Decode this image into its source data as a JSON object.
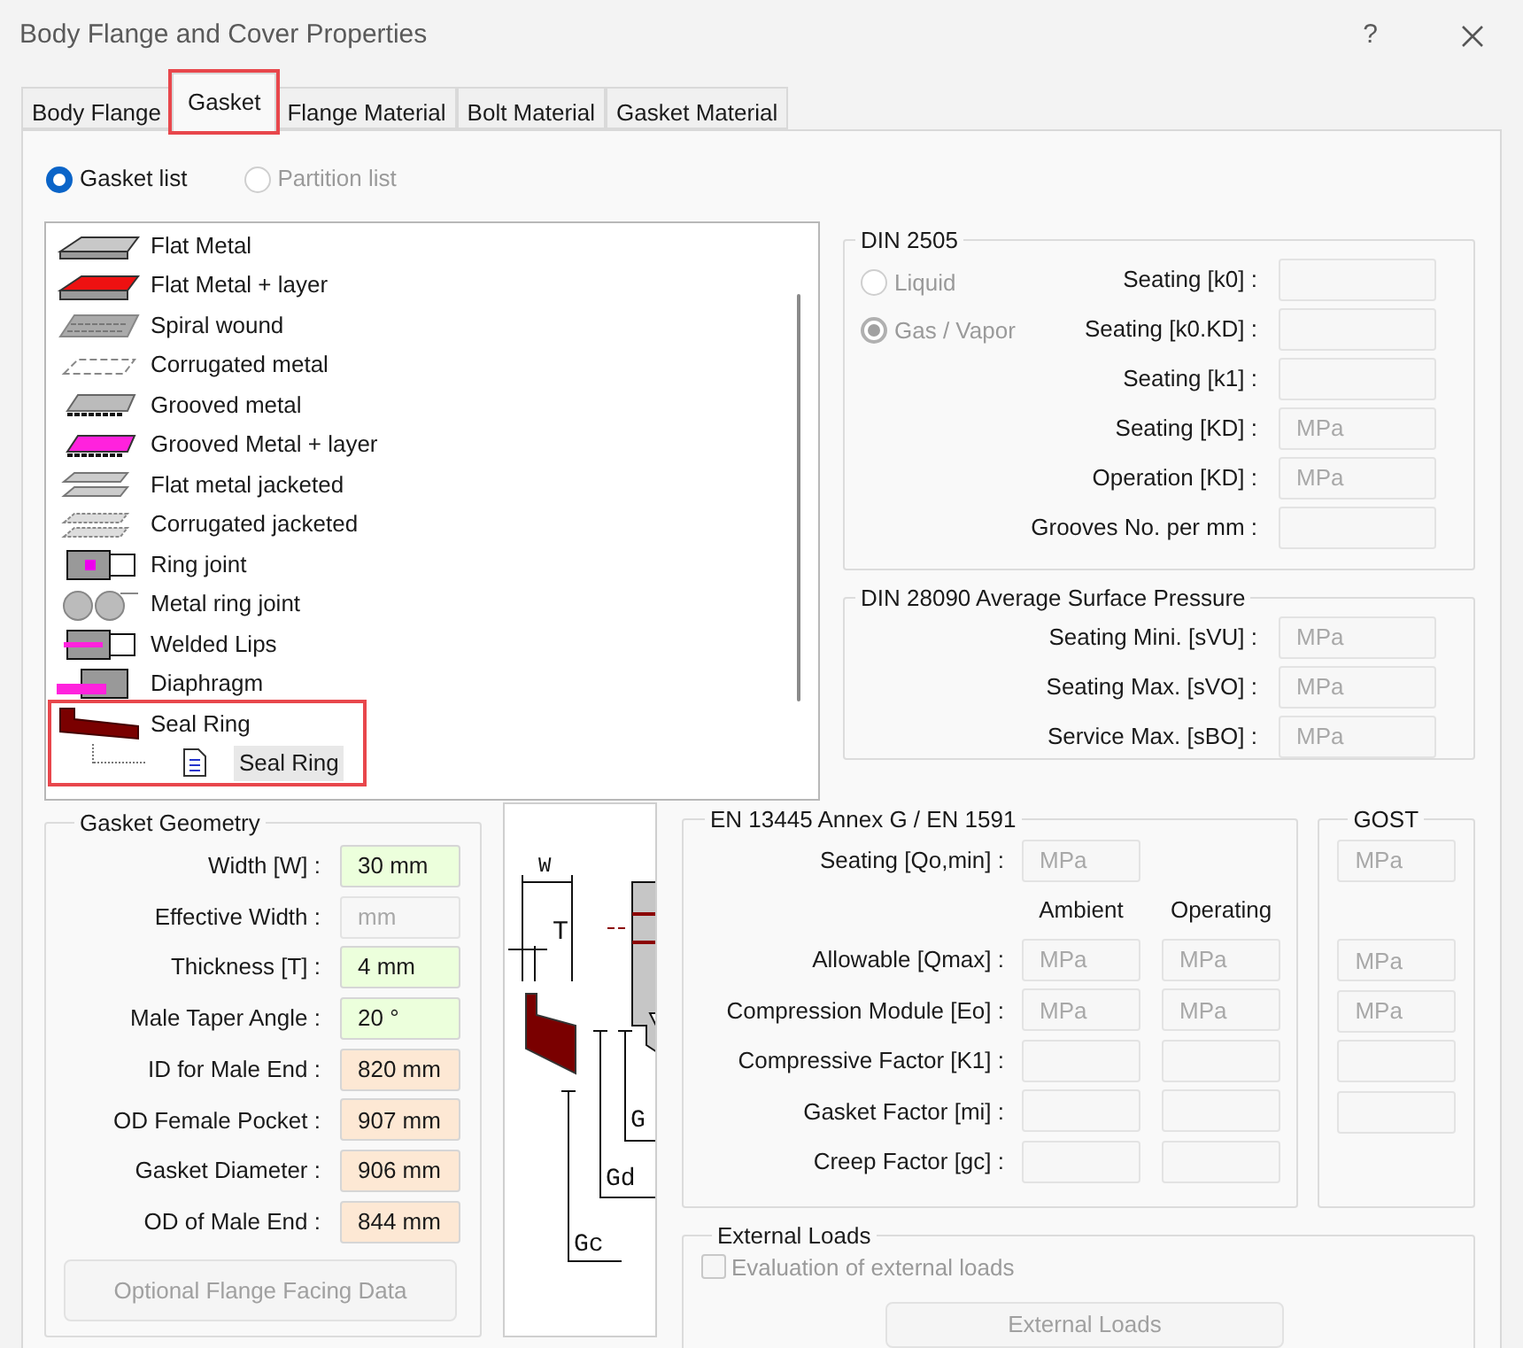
{
  "window": {
    "title": "Body Flange and Cover Properties",
    "help": "?"
  },
  "tabs": [
    {
      "label": "Body Flange",
      "selected": false,
      "highlighted": false
    },
    {
      "label": "Gasket",
      "selected": true,
      "highlighted": true
    },
    {
      "label": "Flange Material",
      "selected": false,
      "highlighted": false
    },
    {
      "label": "Bolt Material",
      "selected": false,
      "highlighted": false
    },
    {
      "label": "Gasket Material",
      "selected": false,
      "highlighted": false
    }
  ],
  "list_mode": [
    {
      "label": "Gasket list",
      "selected": true,
      "disabled": false
    },
    {
      "label": "Partition list",
      "selected": false,
      "disabled": true
    }
  ],
  "gasket_list": {
    "items": [
      {
        "label": "Flat Metal",
        "selected": false,
        "highlighted": false
      },
      {
        "label": "Flat Metal + layer",
        "selected": false,
        "highlighted": false
      },
      {
        "label": "Spiral wound",
        "selected": false,
        "highlighted": false
      },
      {
        "label": "Corrugated metal",
        "selected": false,
        "highlighted": false
      },
      {
        "label": "Grooved metal",
        "selected": false,
        "highlighted": false
      },
      {
        "label": "Grooved Metal + layer",
        "selected": false,
        "highlighted": false
      },
      {
        "label": "Flat metal jacketed",
        "selected": false,
        "highlighted": false
      },
      {
        "label": "Corrugated jacketed",
        "selected": false,
        "highlighted": false
      },
      {
        "label": "Ring joint",
        "selected": false,
        "highlighted": false
      },
      {
        "label": "Metal ring joint",
        "selected": false,
        "highlighted": false
      },
      {
        "label": "Welded Lips",
        "selected": false,
        "highlighted": false
      },
      {
        "label": "Diaphragm",
        "selected": false,
        "highlighted": false
      },
      {
        "label": "Seal Ring",
        "selected": false,
        "highlighted": true,
        "children": [
          {
            "label": "Seal Ring",
            "selected": true
          }
        ]
      }
    ]
  },
  "din_2505": {
    "title": "DIN 2505",
    "media": [
      {
        "label": "Liquid",
        "selected": false,
        "disabled": true
      },
      {
        "label": "Gas / Vapor",
        "selected": true,
        "disabled": true
      }
    ],
    "fields": [
      {
        "label": "Seating [k0] :",
        "kind": "readonly"
      },
      {
        "label": "Seating [k0.KD] :",
        "kind": "readonly"
      },
      {
        "label": "Seating [k1] :",
        "kind": "readonly"
      },
      {
        "label": "Seating [KD] :",
        "kind": "readonly",
        "placeholder": "MPa"
      },
      {
        "label": "Operation [KD] :",
        "kind": "readonly",
        "placeholder": "MPa"
      },
      {
        "label": "Grooves No.  per mm :",
        "kind": "readonly"
      }
    ]
  },
  "din_28090": {
    "title": "DIN 28090 Average Surface Pressure",
    "fields": [
      {
        "label": "Seating Mini. [sVU] :",
        "kind": "readonly",
        "placeholder": "MPa"
      },
      {
        "label": "Seating Max. [sVO] :",
        "kind": "readonly",
        "placeholder": "MPa"
      },
      {
        "label": "Service Max. [sBO] :",
        "kind": "readonly",
        "placeholder": "MPa"
      }
    ]
  },
  "gasket_geometry": {
    "title": "Gasket Geometry",
    "fields": [
      {
        "label": "Width [W] :",
        "kind": "input",
        "value": "30 mm"
      },
      {
        "label": "Effective Width :",
        "kind": "readonly",
        "placeholder": "mm"
      },
      {
        "label": "Thickness [T] :",
        "kind": "input",
        "value": "4 mm"
      },
      {
        "label": "Male Taper Angle :",
        "kind": "input",
        "value": "20 °"
      },
      {
        "label": "ID for Male End :",
        "kind": "computed",
        "value": "820 mm"
      },
      {
        "label": "OD Female Pocket :",
        "kind": "computed",
        "value": "907 mm"
      },
      {
        "label": "Gasket Diameter :",
        "kind": "computed",
        "value": "906 mm"
      },
      {
        "label": "OD of Male End :",
        "kind": "computed",
        "value": "844 mm"
      }
    ],
    "button": {
      "label": "Optional Flange Facing Data",
      "disabled": true
    }
  },
  "drawing": {
    "labels": [
      "W",
      "T",
      "G",
      "Gd",
      "Gc"
    ]
  },
  "en_13445": {
    "title": "EN 13445 Annex G / EN 1591",
    "seating": {
      "label": "Seating [Qo,min] :",
      "kind": "readonly",
      "placeholder": "MPa"
    },
    "columns": [
      "Ambient",
      "Operating"
    ],
    "rows": [
      {
        "label": "Allowable [Qmax] :",
        "fields": [
          {
            "kind": "readonly",
            "placeholder": "MPa"
          },
          {
            "kind": "readonly",
            "placeholder": "MPa"
          }
        ]
      },
      {
        "label": "Compression Module [Eo] :",
        "fields": [
          {
            "kind": "readonly",
            "placeholder": "MPa"
          },
          {
            "kind": "readonly",
            "placeholder": "MPa"
          }
        ]
      },
      {
        "label": "Compressive Factor [K1] :",
        "fields": [
          {
            "kind": "readonly"
          },
          {
            "kind": "readonly"
          }
        ]
      },
      {
        "label": "Gasket Factor [mi] :",
        "fields": [
          {
            "kind": "readonly"
          },
          {
            "kind": "readonly"
          }
        ]
      },
      {
        "label": "Creep Factor [gc] :",
        "fields": [
          {
            "kind": "readonly"
          },
          {
            "kind": "readonly"
          }
        ]
      }
    ]
  },
  "gost": {
    "title": "GOST",
    "fields": [
      {
        "kind": "readonly",
        "placeholder": "MPa"
      },
      {
        "kind": "readonly",
        "placeholder": "MPa"
      },
      {
        "kind": "readonly",
        "placeholder": "MPa"
      },
      {
        "kind": "readonly"
      },
      {
        "kind": "readonly"
      }
    ]
  },
  "external_loads": {
    "title": "External Loads",
    "checkbox": {
      "label": "Evaluation of external loads",
      "checked": false,
      "disabled": true
    },
    "button": {
      "label": "External Loads",
      "disabled": true
    }
  }
}
